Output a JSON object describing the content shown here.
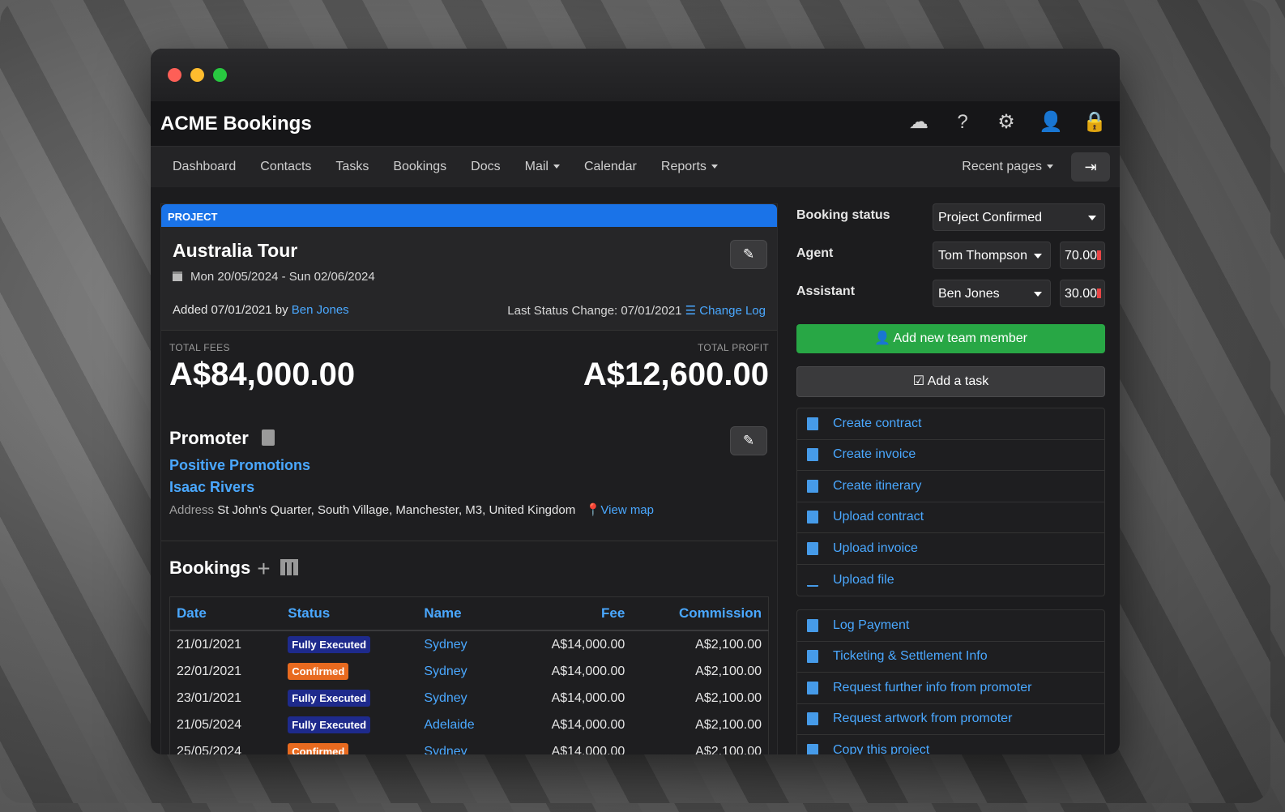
{
  "app": {
    "title": "ACME Bookings"
  },
  "nav": {
    "items": [
      "Dashboard",
      "Contacts",
      "Tasks",
      "Bookings",
      "Docs",
      "Mail",
      "Calendar",
      "Reports"
    ],
    "recent": "Recent pages"
  },
  "project": {
    "tab": "PROJECT",
    "title": "Australia Tour",
    "dates": "Mon 20/05/2024 - Sun 02/06/2024",
    "added_prefix": "Added 07/01/2021 by",
    "added_by": "Ben Jones",
    "last_status": "Last Status Change: 07/01/2021",
    "change_log": "Change Log",
    "total_fees_label": "TOTAL FEES",
    "total_fees": "A$84,000.00",
    "total_profit_label": "TOTAL PROFIT",
    "total_profit": "A$12,600.00"
  },
  "promoter": {
    "title": "Promoter",
    "company": "Positive Promotions",
    "person": "Isaac Rivers",
    "address_label": "Address",
    "address": "St John's Quarter, South Village, Manchester, M3, United Kingdom",
    "view_map": "View map"
  },
  "bookings": {
    "title": "Bookings",
    "columns": [
      "Date",
      "Status",
      "Name",
      "Fee",
      "Commission"
    ],
    "rows": [
      {
        "date": "21/01/2021",
        "status": "Fully Executed",
        "name": "Sydney",
        "fee": "A$14,000.00",
        "commission": "A$2,100.00"
      },
      {
        "date": "22/01/2021",
        "status": "Confirmed",
        "name": "Sydney",
        "fee": "A$14,000.00",
        "commission": "A$2,100.00"
      },
      {
        "date": "23/01/2021",
        "status": "Fully Executed",
        "name": "Sydney",
        "fee": "A$14,000.00",
        "commission": "A$2,100.00"
      },
      {
        "date": "21/05/2024",
        "status": "Fully Executed",
        "name": "Adelaide",
        "fee": "A$14,000.00",
        "commission": "A$2,100.00"
      },
      {
        "date": "25/05/2024",
        "status": "Confirmed",
        "name": "Sydney",
        "fee": "A$14,000.00",
        "commission": "A$2,100.00"
      }
    ]
  },
  "sidebar": {
    "booking_status_label": "Booking status",
    "booking_status": "Project Confirmed",
    "agent_label": "Agent",
    "agent": "Tom Thompson",
    "agent_pct": "70.00",
    "assistant_label": "Assistant",
    "assistant": "Ben Jones",
    "assistant_pct": "30.00",
    "add_member": "Add new team member",
    "add_task": "Add a task",
    "docs": [
      "Create contract",
      "Create invoice",
      "Create itinerary",
      "Upload contract",
      "Upload invoice",
      "Upload file"
    ],
    "actions": [
      "Log Payment",
      "Ticketing & Settlement Info",
      "Request further info from promoter",
      "Request artwork from promoter",
      "Copy this project"
    ]
  },
  "colors": {
    "accent": "#4aa8ff",
    "project_bar": "#1a73e8",
    "green": "#28a745",
    "fully_executed": "#1e2a8c",
    "confirmed": "#e86a1f"
  }
}
